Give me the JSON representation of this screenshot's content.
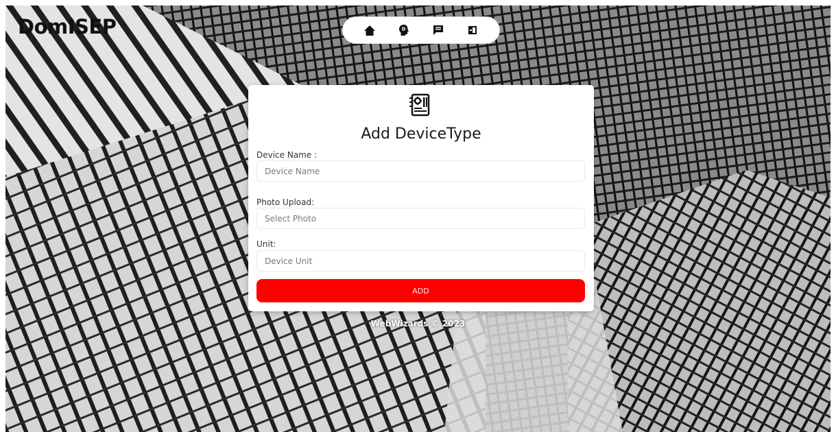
{
  "brand": {
    "name": "DomISEP"
  },
  "nav": {
    "items": [
      {
        "id": "home",
        "icon": "home-icon"
      },
      {
        "id": "support",
        "icon": "lightbulb-head-icon"
      },
      {
        "id": "messages",
        "icon": "message-icon"
      },
      {
        "id": "logout",
        "icon": "logout-icon"
      }
    ]
  },
  "form": {
    "icon": "device-board-icon",
    "title": "Add DeviceType",
    "device_name": {
      "label": "Device Name :",
      "placeholder": "Device Name",
      "value": ""
    },
    "photo": {
      "label": "Photo Upload:",
      "placeholder": "Select Photo",
      "value": ""
    },
    "unit": {
      "label": "Unit:",
      "placeholder": "Device Unit",
      "value": ""
    },
    "submit_label": "ADD"
  },
  "footer": {
    "text": "WebWizards © 2023"
  },
  "colors": {
    "accent": "#ff0000",
    "card_bg": "#ffffff",
    "text": "#1a1a1a"
  }
}
